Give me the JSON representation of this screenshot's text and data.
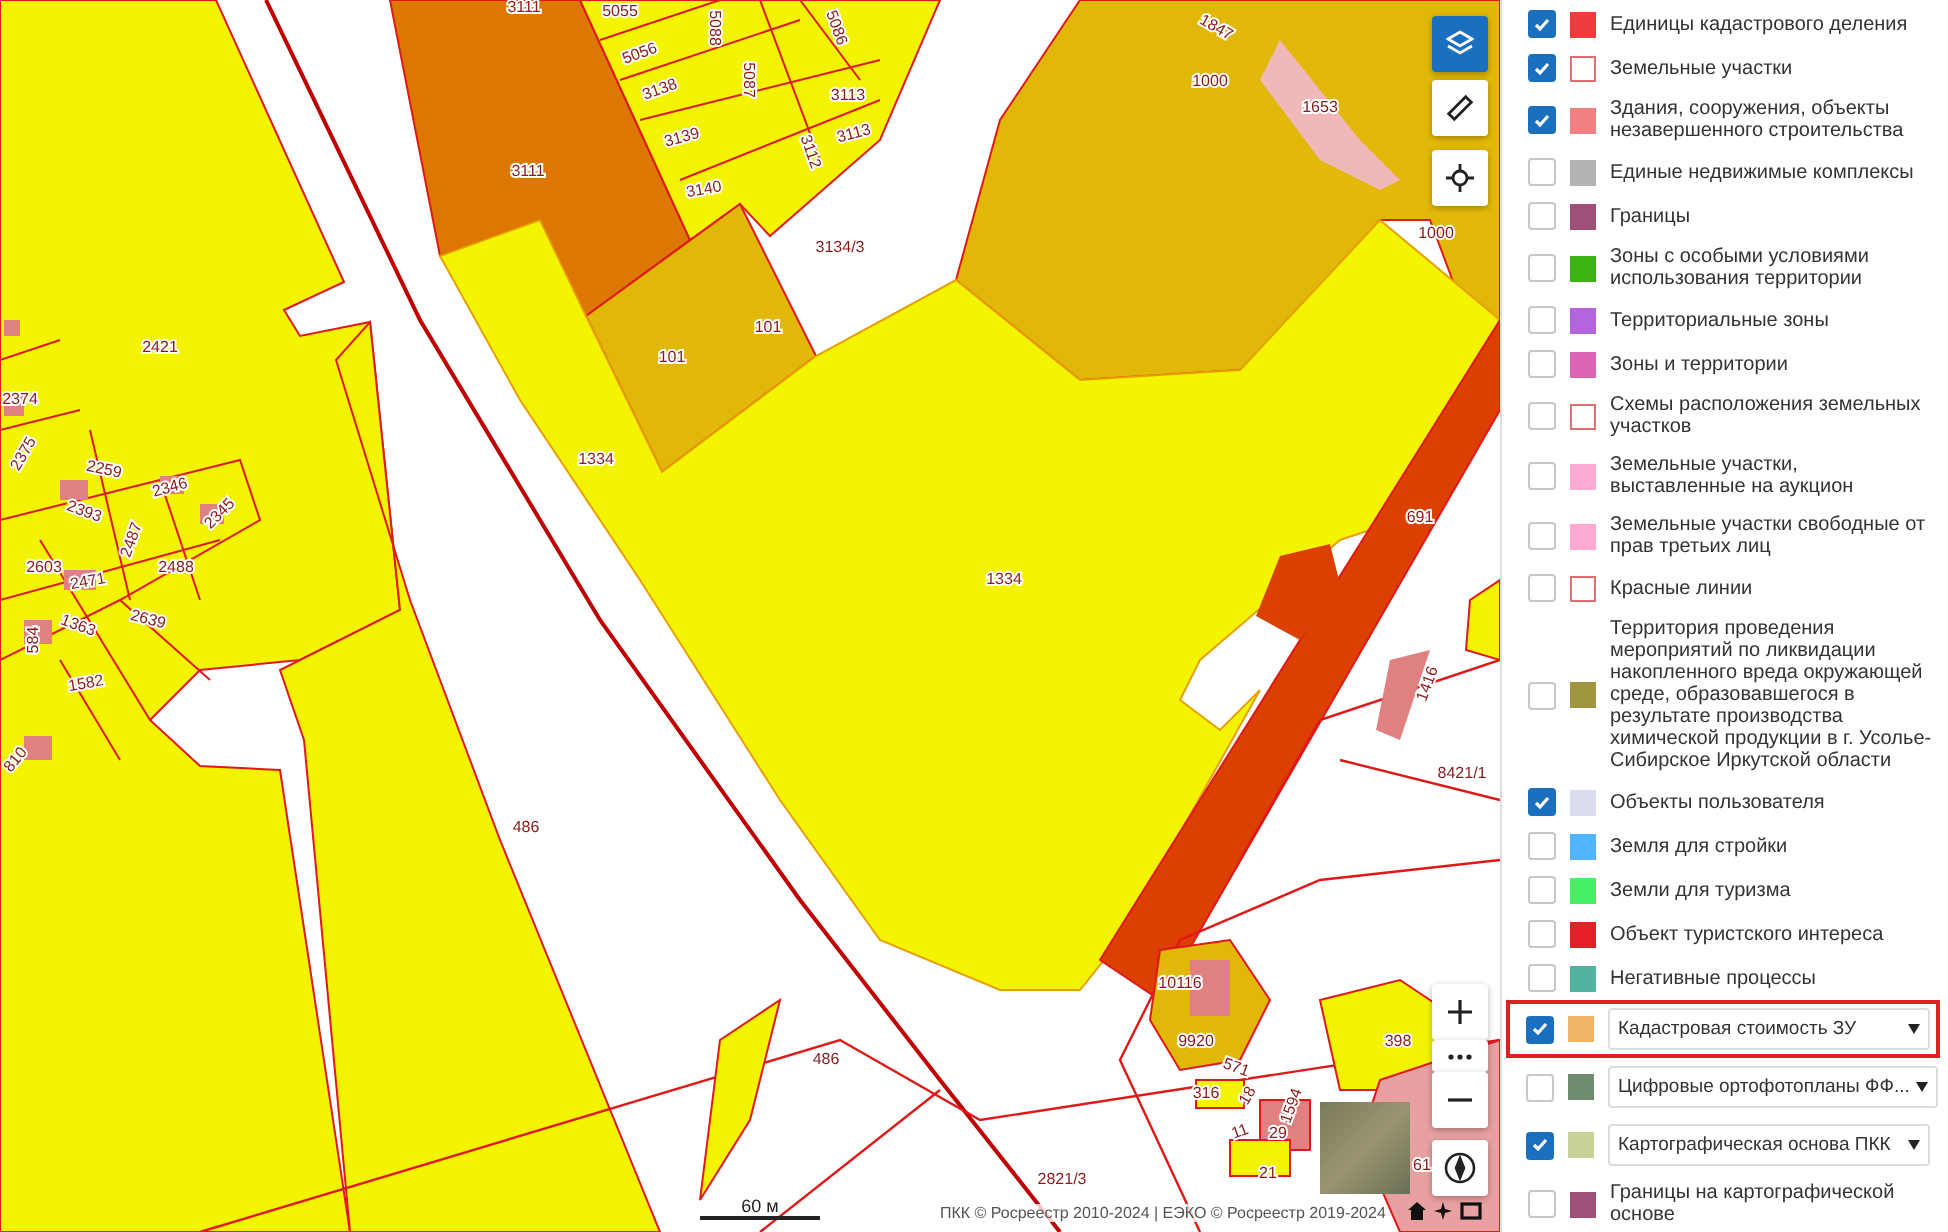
{
  "map": {
    "parcel_labels": [
      "3111",
      "5055",
      "5088",
      "5086",
      "1847",
      "5056",
      "5087",
      "1000",
      "3138",
      "3113",
      "1653",
      "3113",
      "3139",
      "3112",
      "3111",
      "3140",
      "1000",
      "3134/3",
      "101",
      "2421",
      "101",
      "2374",
      "2375",
      "1334",
      "2259",
      "2346",
      "2393",
      "2345",
      "691",
      "2487",
      "2603",
      "2488",
      "1334",
      "2471",
      "2639",
      "1363",
      "584",
      "1582",
      "1416",
      "810",
      "8421/1",
      "486",
      "10116",
      "9920",
      "398",
      "486",
      "571",
      "316",
      "18",
      "1594",
      "11",
      "29",
      "61",
      "21",
      "2821/3"
    ],
    "scale_label": "60 м",
    "attribution": "ПКК © Росреестр 2010-2024 | ЕЭКО © Росреестр 2019-2024",
    "controls": {
      "layers_active": true
    }
  },
  "layers": [
    {
      "label": "Единицы кадастрового деления",
      "checked": true,
      "kind": "plain",
      "color": "#f03c3c",
      "highlighted": false
    },
    {
      "label": "Земельные участки",
      "checked": true,
      "kind": "plain",
      "color": "#ffffff",
      "highlighted": false
    },
    {
      "label": "Здания, сооружения, объекты незавершенного строительства",
      "checked": true,
      "kind": "plain",
      "color": "#f08080",
      "highlighted": false
    },
    {
      "label": "Единые недвижимые комплексы",
      "checked": false,
      "kind": "plain",
      "color": "#b4b4b4",
      "highlighted": false
    },
    {
      "label": "Границы",
      "checked": false,
      "kind": "plain",
      "color": "#a05078",
      "highlighted": false
    },
    {
      "label": "Зоны с особыми условиями использования территории",
      "checked": false,
      "kind": "plain",
      "color": "#3cb414",
      "highlighted": false
    },
    {
      "label": "Территориальные зоны",
      "checked": false,
      "kind": "plain",
      "color": "#b464dc",
      "highlighted": false
    },
    {
      "label": "Зоны и территории",
      "checked": false,
      "kind": "plain",
      "color": "#dc64b4",
      "highlighted": false
    },
    {
      "label": "Схемы расположения земельных участков",
      "checked": false,
      "kind": "plain",
      "color": "#ffffff",
      "highlighted": false
    },
    {
      "label": "Земельные участки, выставленные на аукцион",
      "checked": false,
      "kind": "plain",
      "color": "#ffaad2",
      "highlighted": false
    },
    {
      "label": "Земельные участки свободные от прав третьих лиц",
      "checked": false,
      "kind": "plain",
      "color": "#ffaad2",
      "highlighted": false
    },
    {
      "label": "Красные линии",
      "checked": false,
      "kind": "plain",
      "color": "#ffffff",
      "highlighted": false
    },
    {
      "label": "Территория проведения мероприятий по ликвидации накопленного вреда окружающей среде, образовавшегося в результате производства химической продукции в г. Усолье-Сибирское Иркутской области",
      "checked": false,
      "kind": "plain",
      "color": "#a09640",
      "highlighted": false
    },
    {
      "label": "Объекты пользователя",
      "checked": true,
      "kind": "plain",
      "color": "#dcdcf0",
      "highlighted": false
    },
    {
      "label": "Земля для стройки",
      "checked": false,
      "kind": "plain",
      "color": "#50b4ff",
      "highlighted": false
    },
    {
      "label": "Земли для туризма",
      "checked": false,
      "kind": "plain",
      "color": "#46f064",
      "highlighted": false
    },
    {
      "label": "Объект туристского интереса",
      "checked": false,
      "kind": "plain",
      "color": "#e61e28",
      "highlighted": false
    },
    {
      "label": "Негативные процессы",
      "checked": false,
      "kind": "plain",
      "color": "#50b4a0",
      "highlighted": false
    },
    {
      "label": "Кадастровая стоимость ЗУ",
      "checked": true,
      "kind": "dropdown",
      "color": "#f0b464",
      "highlighted": true
    },
    {
      "label": "Цифровые ортофотопланы ФФ...",
      "checked": false,
      "kind": "dropdown",
      "color": "#6e8c6e",
      "highlighted": false
    },
    {
      "label": "Картографическая основа ПКК",
      "checked": true,
      "kind": "dropdown",
      "color": "#c8d296",
      "highlighted": false
    },
    {
      "label": "Границы на картографической основе",
      "checked": false,
      "kind": "plain",
      "color": "#a05078",
      "highlighted": false
    }
  ]
}
